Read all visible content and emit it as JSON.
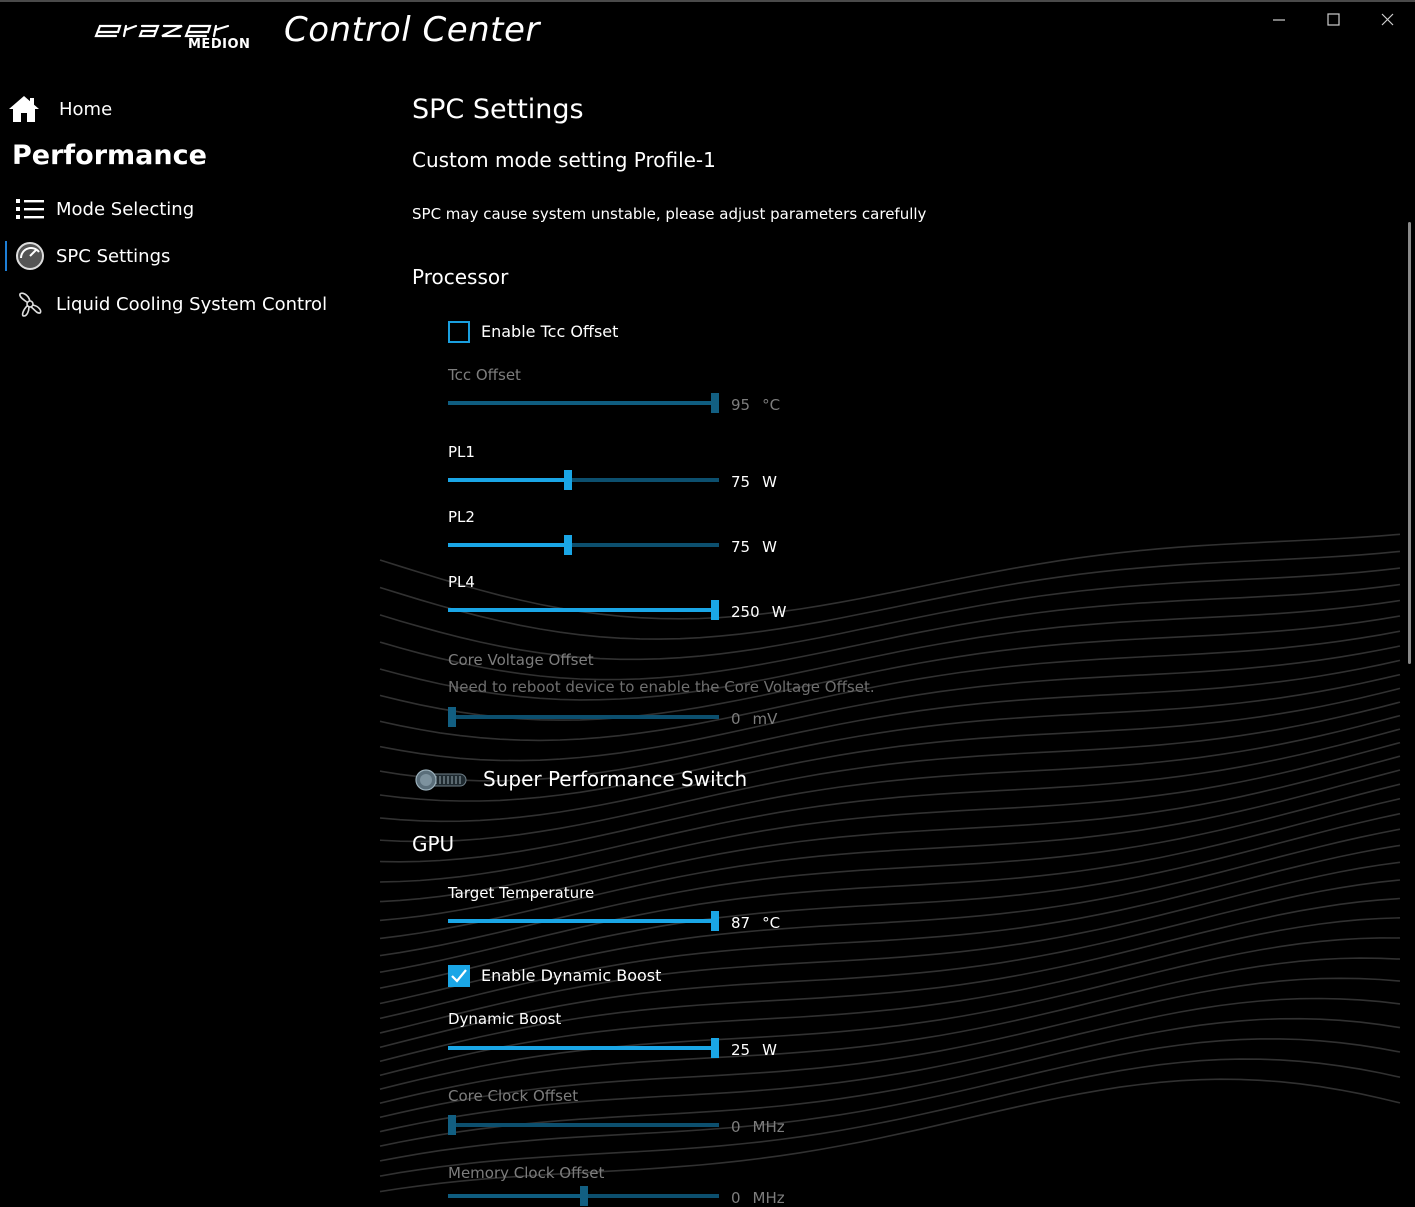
{
  "window": {
    "app_title": "Control Center",
    "logo_brand": "erazer",
    "logo_sub": "MEDION"
  },
  "sidebar": {
    "home_label": "Home",
    "section_title": "Performance",
    "items": [
      {
        "label": "Mode Selecting",
        "icon": "list-icon"
      },
      {
        "label": "SPC Settings",
        "icon": "gauge-icon",
        "active": true
      },
      {
        "label": "Liquid Cooling System Control",
        "icon": "fan-icon"
      }
    ]
  },
  "content": {
    "title": "SPC Settings",
    "subtitle": "Custom mode setting Profile-1",
    "warning": "SPC may cause system unstable, please adjust parameters carefully",
    "processor": {
      "heading": "Processor",
      "enable_tcc": {
        "label": "Enable Tcc Offset",
        "checked": false
      },
      "tcc_offset": {
        "label": "Tcc Offset",
        "value": "95",
        "unit": "°C",
        "fraction": 1.0,
        "disabled": true
      },
      "pl1": {
        "label": "PL1",
        "value": "75",
        "unit": "W",
        "fraction": 0.44
      },
      "pl2": {
        "label": "PL2",
        "value": "75",
        "unit": "W",
        "fraction": 0.44
      },
      "pl4": {
        "label": "PL4",
        "value": "250",
        "unit": "W",
        "fraction": 1.0
      },
      "core_voltage": {
        "label": "Core Voltage Offset",
        "note": "Need to reboot device to enable the Core Voltage Offset.",
        "value": "0",
        "unit": "mV",
        "fraction": 0.0,
        "disabled": true
      }
    },
    "super_switch": {
      "label": "Super Performance Switch",
      "on": false
    },
    "gpu": {
      "heading": "GPU",
      "target_temp": {
        "label": "Target Temperature",
        "value": "87",
        "unit": "°C",
        "fraction": 1.0
      },
      "enable_dynamic_boost": {
        "label": "Enable Dynamic Boost",
        "checked": true
      },
      "dynamic_boost": {
        "label": "Dynamic Boost",
        "value": "25",
        "unit": "W",
        "fraction": 1.0
      },
      "core_clock": {
        "label": "Core Clock Offset",
        "value": "0",
        "unit": "MHz",
        "fraction": 0.0,
        "disabled": true
      },
      "memory_clock": {
        "label": "Memory Clock Offset",
        "value": "0",
        "unit": "MHz",
        "fraction": 0.5,
        "disabled": true
      }
    }
  },
  "colors": {
    "accent": "#1aa6e6",
    "track": "#0c4f6e",
    "disabled_text": "#7d7d7d",
    "background": "#000000"
  }
}
